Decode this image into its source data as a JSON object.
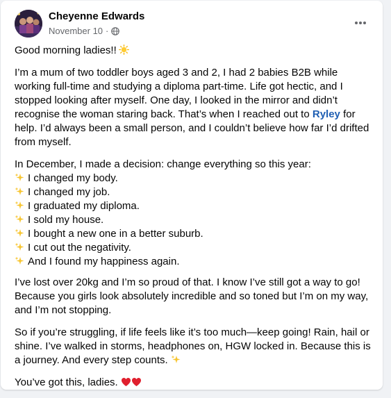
{
  "post": {
    "author": "Cheyenne Edwards",
    "date": "November 10",
    "separator": "·",
    "greeting": "Good morning ladies!!",
    "para1_before": "I’m a mum of two toddler boys aged 3 and 2, I had 2 babies B2B while working full-time and studying a diploma part-time. Life got hectic, and I stopped looking after myself. One day, I looked in the mirror and didn’t recognise the woman staring back. That’s when I reached out to ",
    "para1_mention": "Ryley",
    "para1_after": " for help. I’d always been a small person, and I couldn’t believe how far I’d drifted from myself.",
    "para2_intro": "In December, I made a decision: change everything so this year:",
    "changes": [
      "I changed my body.",
      "I changed my job.",
      "I graduated my diploma.",
      "I sold my house.",
      "I bought a new one in a better suburb.",
      "I cut out the negativity.",
      "And I found my happiness again."
    ],
    "para3": "I’ve lost over 20kg and I’m so proud of that. I know I’ve still got a way to go! Because you girls look absolutely incredible and so toned but I’m on my way, and I’m not stopping.",
    "para4": "So if you’re struggling, if life feels like it’s too much—keep going! Rain, hail or shine. I’ve walked in storms, headphones on, HGW locked in. Because this is a journey. And every step counts.",
    "closing": "You’ve got this, ladies."
  },
  "icons": {
    "privacy": "globe-icon",
    "more": "more-horizontal-icon",
    "sun": "sun-emoji-icon",
    "sparkle": "sparkles-emoji-icon",
    "heart": "red-heart-emoji-icon"
  },
  "colors": {
    "mention": "#1f5fb3",
    "meta": "#65676b",
    "text": "#050505",
    "background": "#f0f2f5",
    "card": "#ffffff"
  }
}
